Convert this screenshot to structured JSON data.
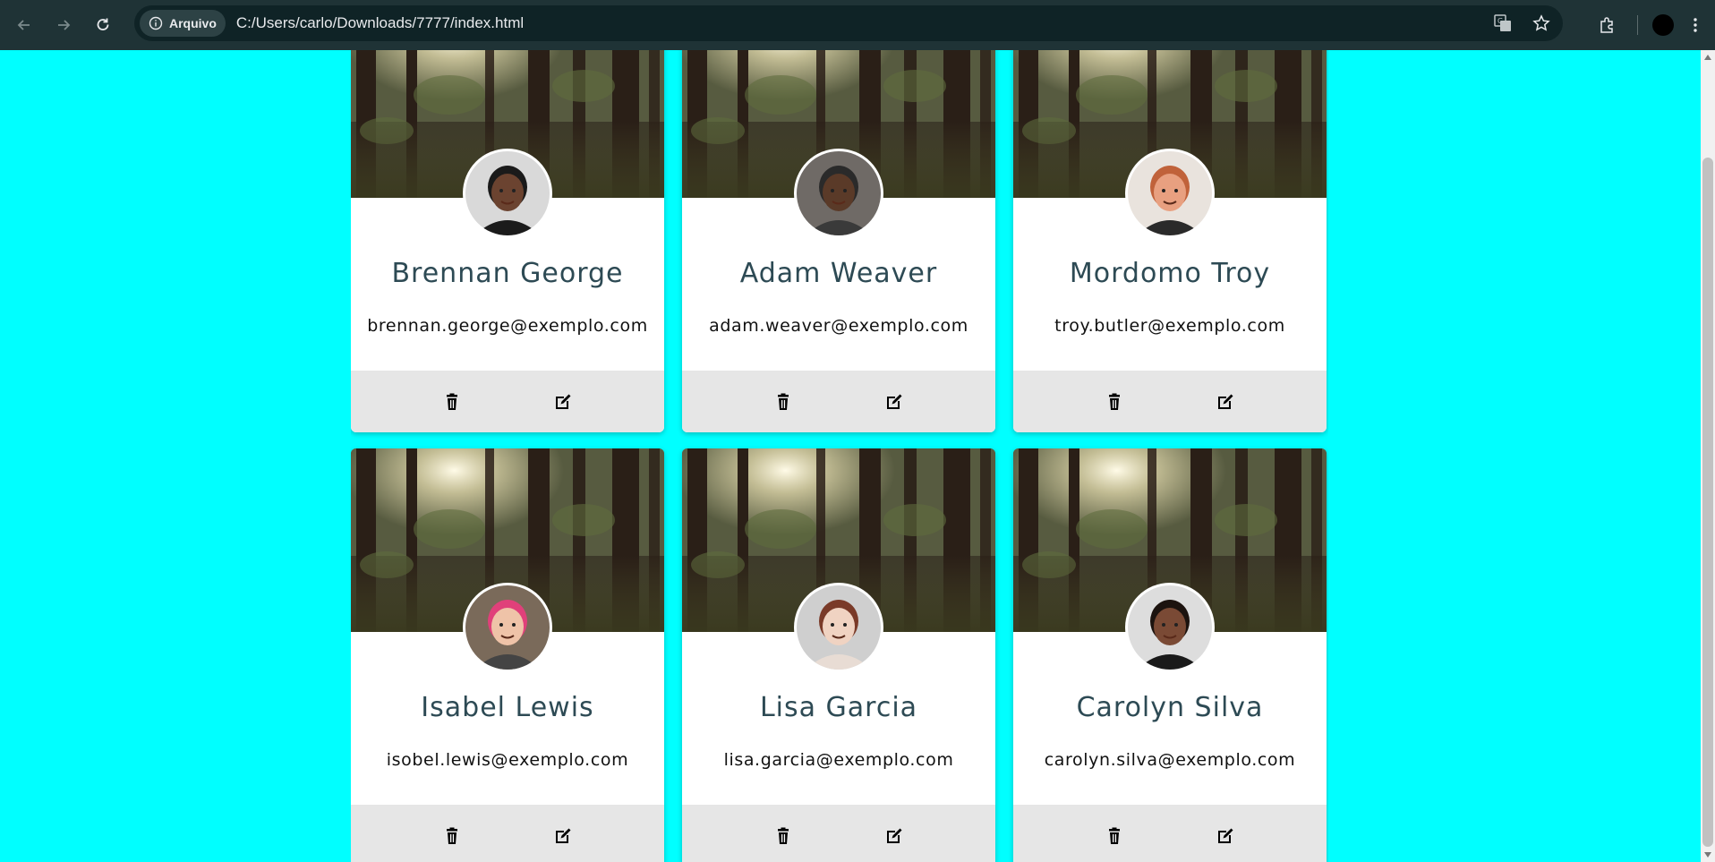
{
  "browser": {
    "site_chip_label": "Arquivo",
    "url": "C:/Users/carlo/Downloads/7777/index.html"
  },
  "cards": [
    {
      "name": "Brennan George",
      "email": "brennan.george@exemplo.com",
      "avatar": {
        "skin": "#6b4330",
        "hair": "#1a1a1a",
        "shirt": "#1b1b1b",
        "bg": "#d9d9d9"
      }
    },
    {
      "name": "Adam Weaver",
      "email": "adam.weaver@exemplo.com",
      "avatar": {
        "skin": "#5a3a28",
        "hair": "#2a2a2a",
        "shirt": "#3a3a3a",
        "bg": "#6f6a66"
      }
    },
    {
      "name": "Mordomo Troy",
      "email": "troy.butler@exemplo.com",
      "avatar": {
        "skin": "#e8a080",
        "hair": "#c0623a",
        "shirt": "#2a2a2a",
        "bg": "#e9e3dd"
      }
    },
    {
      "name": "Isabel Lewis",
      "email": "isobel.lewis@exemplo.com",
      "avatar": {
        "skin": "#efc3a8",
        "hair": "#e0407a",
        "shirt": "#444",
        "bg": "#7a6a5a"
      }
    },
    {
      "name": "Lisa Garcia",
      "email": "lisa.garcia@exemplo.com",
      "avatar": {
        "skin": "#f0d3c2",
        "hair": "#7a3a28",
        "shirt": "#e8dcd4",
        "bg": "#cfcfcf"
      }
    },
    {
      "name": "Carolyn Silva",
      "email": "carolyn.silva@exemplo.com",
      "avatar": {
        "skin": "#7a4a35",
        "hair": "#1c130f",
        "shirt": "#1a1a1a",
        "bg": "#ddd"
      }
    }
  ],
  "icons": {
    "delete": "trash-icon",
    "edit": "edit-icon"
  }
}
